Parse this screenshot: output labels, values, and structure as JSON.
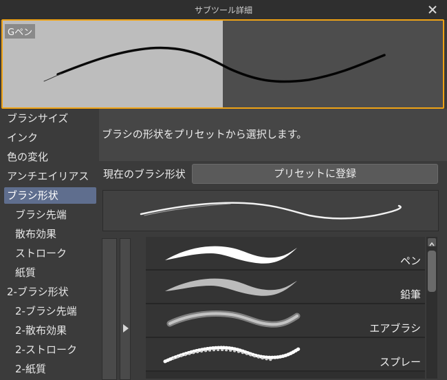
{
  "window": {
    "title": "サブツール詳細"
  },
  "preview": {
    "tool_label": "Gペン"
  },
  "sidebar": {
    "items": [
      {
        "label": "ブラシサイズ"
      },
      {
        "label": "インク"
      },
      {
        "label": "色の変化"
      },
      {
        "label": "アンチエイリアス"
      },
      {
        "label": "ブラシ形状"
      },
      {
        "label": "ブラシ先端"
      },
      {
        "label": "散布効果"
      },
      {
        "label": "ストローク"
      },
      {
        "label": "紙質"
      },
      {
        "label": "2-ブラシ形状"
      },
      {
        "label": "2-ブラシ先端"
      },
      {
        "label": "2-散布効果"
      },
      {
        "label": "2-ストローク"
      },
      {
        "label": "2-紙質"
      }
    ],
    "selected": "ブラシ形状"
  },
  "panel": {
    "description": "ブラシの形状をプリセットから選択します。",
    "current_label": "現在のブラシ形状",
    "register_button": "プリセットに登録",
    "presets": [
      {
        "name": "ペン"
      },
      {
        "name": "鉛筆"
      },
      {
        "name": "エアブラシ"
      },
      {
        "name": "スプレー"
      }
    ]
  },
  "colors": {
    "highlight_border": "#f0a314",
    "selected_item": "#5f6e8e"
  }
}
